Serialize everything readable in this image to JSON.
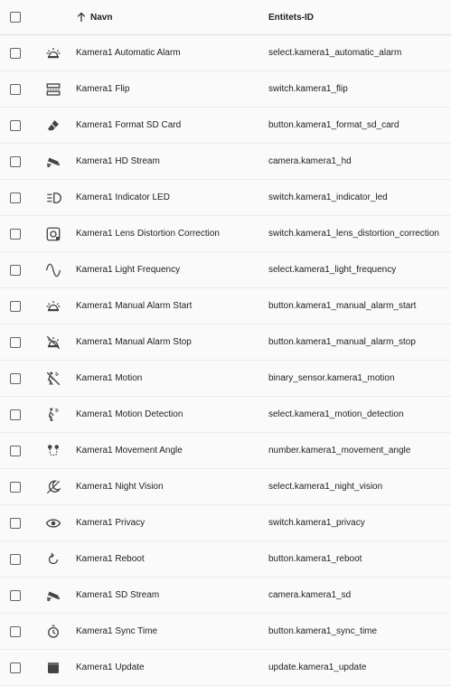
{
  "header": {
    "name_label": "Navn",
    "id_label": "Entitets-ID"
  },
  "rows": [
    {
      "icon": "alarm-light-icon",
      "name": "Kamera1 Automatic Alarm",
      "entity_id": "select.kamera1_automatic_alarm"
    },
    {
      "icon": "flip-icon",
      "name": "Kamera1 Flip",
      "entity_id": "switch.kamera1_flip"
    },
    {
      "icon": "eraser-icon",
      "name": "Kamera1 Format SD Card",
      "entity_id": "button.kamera1_format_sd_card"
    },
    {
      "icon": "cctv-icon",
      "name": "Kamera1 HD Stream",
      "entity_id": "camera.kamera1_hd"
    },
    {
      "icon": "led-indicator-icon",
      "name": "Kamera1 Indicator LED",
      "entity_id": "switch.kamera1_indicator_led"
    },
    {
      "icon": "lens-icon",
      "name": "Kamera1 Lens Distortion Correction",
      "entity_id": "switch.kamera1_lens_distortion_correction"
    },
    {
      "icon": "sine-wave-icon",
      "name": "Kamera1 Light Frequency",
      "entity_id": "select.kamera1_light_frequency"
    },
    {
      "icon": "alarm-light-icon",
      "name": "Kamera1 Manual Alarm Start",
      "entity_id": "button.kamera1_manual_alarm_start"
    },
    {
      "icon": "alarm-light-off-icon",
      "name": "Kamera1 Manual Alarm Stop",
      "entity_id": "button.kamera1_manual_alarm_stop"
    },
    {
      "icon": "motion-sensor-off-icon",
      "name": "Kamera1 Motion",
      "entity_id": "binary_sensor.kamera1_motion"
    },
    {
      "icon": "motion-sensor-icon",
      "name": "Kamera1 Motion Detection",
      "entity_id": "select.kamera1_motion_detection"
    },
    {
      "icon": "map-marker-path-icon",
      "name": "Kamera1 Movement Angle",
      "entity_id": "number.kamera1_movement_angle"
    },
    {
      "icon": "weather-night-icon",
      "name": "Kamera1 Night Vision",
      "entity_id": "select.kamera1_night_vision"
    },
    {
      "icon": "eye-icon",
      "name": "Kamera1 Privacy",
      "entity_id": "switch.kamera1_privacy"
    },
    {
      "icon": "restart-icon",
      "name": "Kamera1 Reboot",
      "entity_id": "button.kamera1_reboot"
    },
    {
      "icon": "cctv-icon",
      "name": "Kamera1 SD Stream",
      "entity_id": "camera.kamera1_sd"
    },
    {
      "icon": "timer-sync-icon",
      "name": "Kamera1 Sync Time",
      "entity_id": "button.kamera1_sync_time"
    },
    {
      "icon": "package-up-icon",
      "name": "Kamera1 Update",
      "entity_id": "update.kamera1_update"
    }
  ]
}
